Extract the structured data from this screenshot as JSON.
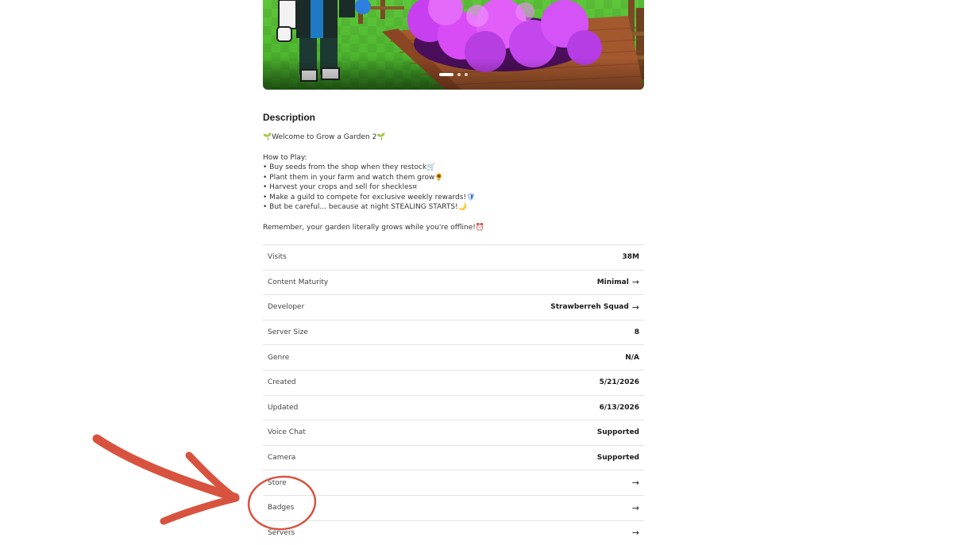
{
  "hero": {
    "carousel_pages": 3,
    "active_page": 1
  },
  "description": {
    "heading": "Description",
    "welcome": "Welcome to Grow a Garden 2",
    "how_to_play": "How to Play:",
    "bullets": [
      "• Buy seeds from the shop when they restock",
      "• Plant them in your farm and watch them grow",
      "• Harvest your crops and sell for sheckles",
      "• Make a guild to compete for exclusive weekly rewards!",
      "• But be careful... because at night STEALING STARTS!"
    ],
    "remember": "Remember, your garden literally grows while you're offline!"
  },
  "details": [
    {
      "label": "Visits",
      "value": "38M",
      "arrow": false
    },
    {
      "label": "Content Maturity",
      "value": "Minimal",
      "arrow": true
    },
    {
      "label": "Developer",
      "value": "Strawberreh Squad",
      "arrow": true
    },
    {
      "label": "Server Size",
      "value": "8",
      "arrow": false
    },
    {
      "label": "Genre",
      "value": "N/A",
      "arrow": false
    },
    {
      "label": "Created",
      "value": "5/21/2026",
      "arrow": false
    },
    {
      "label": "Updated",
      "value": "6/13/2026",
      "arrow": false
    },
    {
      "label": "Voice Chat",
      "value": "Supported",
      "arrow": false
    },
    {
      "label": "Camera",
      "value": "Supported",
      "arrow": false
    },
    {
      "label": "Store",
      "value": "",
      "arrow": true
    },
    {
      "label": "Badges",
      "value": "",
      "arrow": true
    },
    {
      "label": "Servers",
      "value": "",
      "arrow": true
    }
  ],
  "arrow_glyph": "→",
  "annotation": {
    "color": "#d8533f",
    "highlighted_row": "Badges"
  }
}
